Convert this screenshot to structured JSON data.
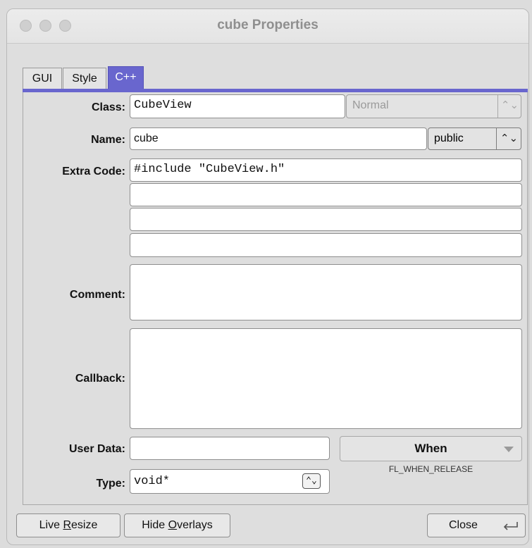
{
  "window": {
    "title": "cube Properties"
  },
  "tabs": [
    {
      "label": "GUI",
      "active": false
    },
    {
      "label": "Style",
      "active": false
    },
    {
      "label": "C++",
      "active": true
    }
  ],
  "form": {
    "class_label": "Class:",
    "class_value": "CubeView",
    "class_mode": "Normal",
    "name_label": "Name:",
    "name_value": "cube",
    "visibility": "public",
    "extra_code_label": "Extra Code:",
    "extra_code": [
      "#include \"CubeView.h\"",
      "",
      "",
      ""
    ],
    "comment_label": "Comment:",
    "comment_value": "",
    "callback_label": "Callback:",
    "callback_value": "",
    "user_data_label": "User Data:",
    "user_data_value": "",
    "type_label": "Type:",
    "type_value": "void*",
    "when_label": "When",
    "when_value": "FL_WHEN_RELEASE"
  },
  "footer": {
    "live_resize_pre": "Live ",
    "live_resize_mnemonic": "R",
    "live_resize_post": "esize",
    "hide_overlays_pre": "Hide ",
    "hide_overlays_mnemonic": "O",
    "hide_overlays_post": "verlays",
    "close_label": "Close"
  },
  "icons": {
    "updown": "⌃⌄",
    "updown_icon": "updown-chevron-icon",
    "when_icon": "chevron-down-icon",
    "return_icon": "return-key-icon"
  },
  "colors": {
    "accent": "#6966ce"
  }
}
